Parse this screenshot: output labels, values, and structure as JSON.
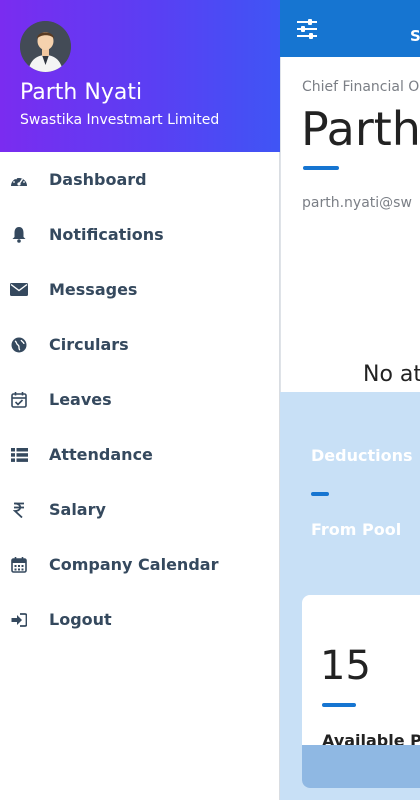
{
  "app": {
    "topbar_title": "S",
    "profile": {
      "designation": "Chief Financial O",
      "big_name": "Parth",
      "email": "parth.nyati@sw",
      "attendance_message": "No at"
    },
    "deductions": {
      "title": "Deductions",
      "from_pool": "From Pool"
    },
    "leave_card": {
      "count": "15",
      "label": "Available P"
    }
  },
  "drawer": {
    "user_name": "Parth Nyati",
    "company": "Swastika Investmart Limited",
    "items": [
      {
        "label": "Dashboard",
        "icon": "dashboard-icon"
      },
      {
        "label": "Notifications",
        "icon": "bell-icon"
      },
      {
        "label": "Messages",
        "icon": "envelope-icon"
      },
      {
        "label": "Circulars",
        "icon": "globe-icon"
      },
      {
        "label": "Leaves",
        "icon": "calendar-check-icon"
      },
      {
        "label": "Attendance",
        "icon": "list-icon"
      },
      {
        "label": "Salary",
        "icon": "rupee-icon"
      },
      {
        "label": "Company Calendar",
        "icon": "calendar-icon"
      },
      {
        "label": "Logout",
        "icon": "logout-icon"
      }
    ]
  },
  "colors": {
    "primary": "#1675d1",
    "header_gradient_start": "#7a2cf0",
    "header_gradient_end": "#3f55f5",
    "menu_text": "#35495e"
  }
}
